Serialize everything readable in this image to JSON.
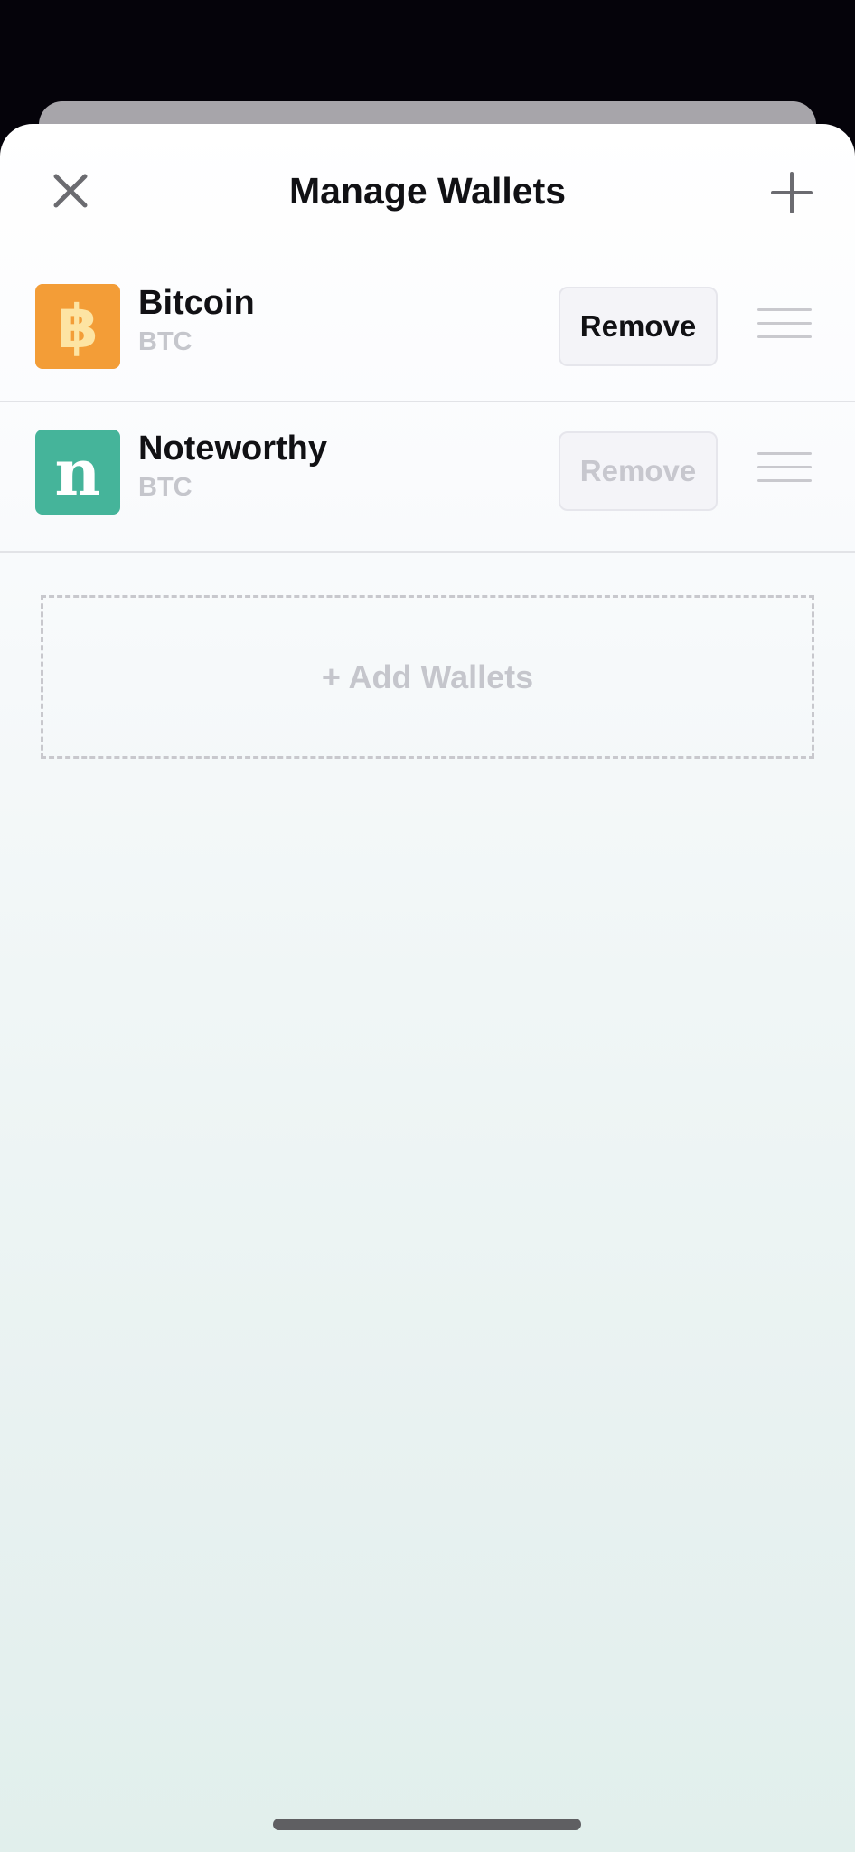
{
  "header": {
    "title": "Manage Wallets",
    "close_icon": "close-icon",
    "add_icon": "plus-icon"
  },
  "wallets": [
    {
      "name": "Bitcoin",
      "ticker": "BTC",
      "logo_glyph": "฿",
      "logo_color": "#f39d37",
      "remove_label": "Remove",
      "remove_enabled": true
    },
    {
      "name": "Noteworthy",
      "ticker": "BTC",
      "logo_glyph": "n",
      "logo_color": "#45b49a",
      "remove_label": "Remove",
      "remove_enabled": false
    }
  ],
  "add_wallets_label": "+ Add Wallets"
}
